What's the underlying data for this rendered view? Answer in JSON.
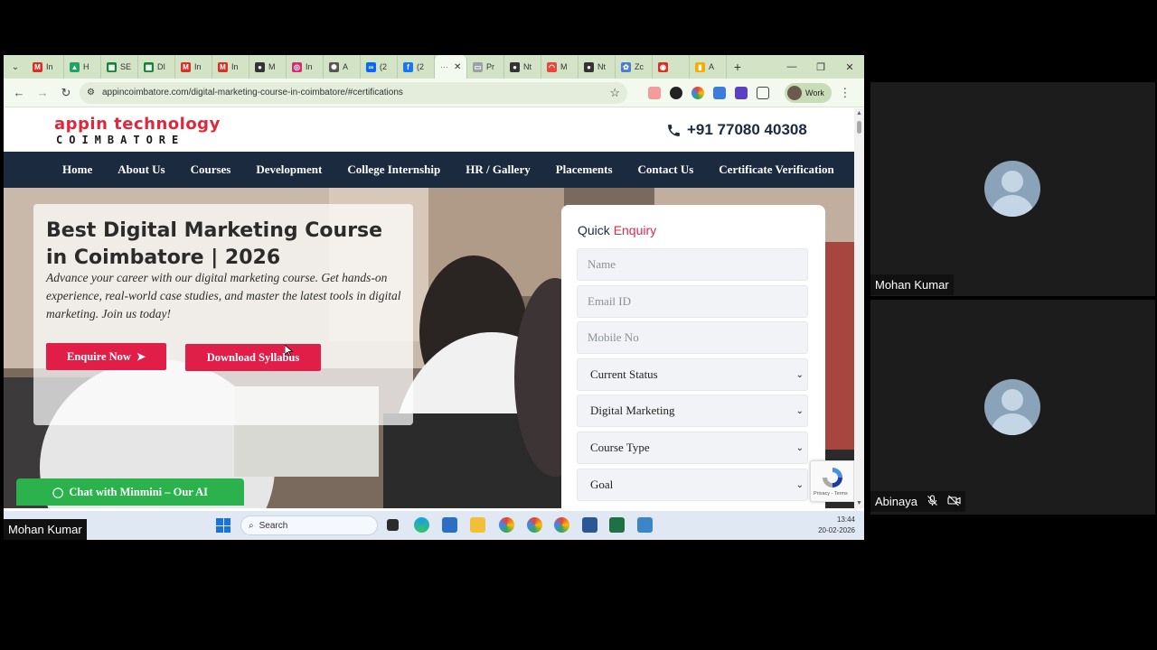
{
  "browser": {
    "tabs": [
      {
        "label": "In",
        "icon": "gmail-icon",
        "color": "#d93025",
        "glyph": "M"
      },
      {
        "label": "H",
        "icon": "google-drive-icon",
        "color": "#1fa463",
        "glyph": "▲"
      },
      {
        "label": "SE",
        "icon": "google-sheets-icon",
        "color": "#188038",
        "glyph": "▦"
      },
      {
        "label": "DI",
        "icon": "google-sheets-icon",
        "color": "#188038",
        "glyph": "▦"
      },
      {
        "label": "In",
        "icon": "gmail-icon",
        "color": "#d93025",
        "glyph": "M"
      },
      {
        "label": "In",
        "icon": "gmail-icon",
        "color": "#d93025",
        "glyph": "M"
      },
      {
        "label": "M",
        "icon": "github-icon",
        "color": "#333333",
        "glyph": "●"
      },
      {
        "label": "In",
        "icon": "instagram-icon",
        "color": "#d62976",
        "glyph": "◎"
      },
      {
        "label": "A",
        "icon": "openai-icon",
        "color": "#555555",
        "glyph": "✺"
      },
      {
        "label": "(2",
        "icon": "meta-icon",
        "color": "#0866ff",
        "glyph": "∞"
      },
      {
        "label": "(2",
        "icon": "facebook-icon",
        "color": "#1877f2",
        "glyph": "f"
      },
      {
        "label": "Pr",
        "icon": "doc-icon",
        "color": "#9aa0a6",
        "glyph": "▭"
      },
      {
        "label": "Nt",
        "icon": "github-icon",
        "color": "#333333",
        "glyph": "●"
      },
      {
        "label": "M",
        "icon": "rainbow-icon",
        "color": "#e8453c",
        "glyph": "◠"
      },
      {
        "label": "Nt",
        "icon": "github-icon",
        "color": "#333333",
        "glyph": "●"
      },
      {
        "label": "Zc",
        "icon": "zoho-icon",
        "color": "#4a7bd8",
        "glyph": "✿"
      },
      {
        "label": "",
        "icon": "record-icon",
        "color": "#d93025",
        "glyph": "◉"
      },
      {
        "label": "A",
        "icon": "analytics-icon",
        "color": "#f9ab00",
        "glyph": "▮"
      }
    ],
    "url": "appincoimbatore.com/digital-marketing-course-in-coimbatore/#certifications",
    "profile_label": "Work"
  },
  "site": {
    "logo_top": "appin technology",
    "logo_bottom": "COIMBATORE",
    "phone": "+91 77080 40308",
    "nav": [
      "Home",
      "About Us",
      "Courses",
      "Development",
      "College Internship",
      "HR / Gallery",
      "Placements",
      "Contact Us",
      "Certificate Verification"
    ],
    "hero": {
      "title": "Best Digital Marketing Course in Coimbatore | 2026",
      "subtitle": "Advance your career with our digital marketing course. Get hands-on experience, real-world case studies, and master the latest tools in digital marketing. Join us today!",
      "enquire_label": "Enquire Now",
      "syllabus_label": "Download Syllabus"
    },
    "chat_label": "Chat with Minmini – Our AI",
    "enquiry": {
      "title_a": "Quick",
      "title_b": "Enquiry",
      "name_placeholder": "Name",
      "email_placeholder": "Email ID",
      "mobile_placeholder": "Mobile No",
      "status_value": "Current Status",
      "course_value": "Digital Marketing",
      "type_value": "Course Type",
      "goal_value": "Goal"
    },
    "recaptcha_text": "Privacy - Terms"
  },
  "taskbar": {
    "search_placeholder": "Search",
    "time": "13:44",
    "date": "20-02-2026"
  },
  "meeting": {
    "presenter_name": "Mohan Kumar",
    "participants": [
      {
        "name": "Mohan Kumar"
      },
      {
        "name": "Abinaya"
      }
    ]
  },
  "colors": {
    "brand_red": "#e01e48",
    "nav_dark": "#1b2a3e",
    "whatsapp_green": "#2bb24c",
    "tab_strip": "#d3e3c6"
  }
}
